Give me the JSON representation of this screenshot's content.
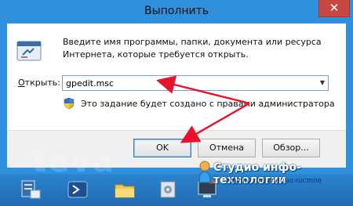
{
  "window": {
    "title": "Выполнить",
    "close_glyph": "✕"
  },
  "dialog": {
    "description_line1": "Введите имя программы, папки, документа или ресурса",
    "description_line2": "Интернета, которые требуется открыть.",
    "open_label_accel": "О",
    "open_label_rest": "ткрыть:",
    "open_value": "gpedit.msc",
    "dropdown_glyph": "▼",
    "admin_note": "Это задание будет создано с правами администратора",
    "buttons": {
      "ok": "OK",
      "cancel": "Отмена",
      "browse": "Обзор..."
    }
  },
  "icons": [
    "run-program-icon",
    "uac-shield-icon",
    "close-icon",
    "chevron-down-icon",
    "server-manager-icon",
    "powershell-icon",
    "file-explorer-icon",
    "admin-tools-icon",
    "remote-desktop-icon",
    "brand-logo-icon"
  ],
  "branding": {
    "name": "Студио инфо-технологии",
    "tagline": "группа ит специалистов",
    "watermark": "teva"
  },
  "colors": {
    "title_bar": "#2f91de",
    "close_button": "#c74741",
    "arrow": "#e8132b",
    "taskbar": "#2377c2"
  }
}
